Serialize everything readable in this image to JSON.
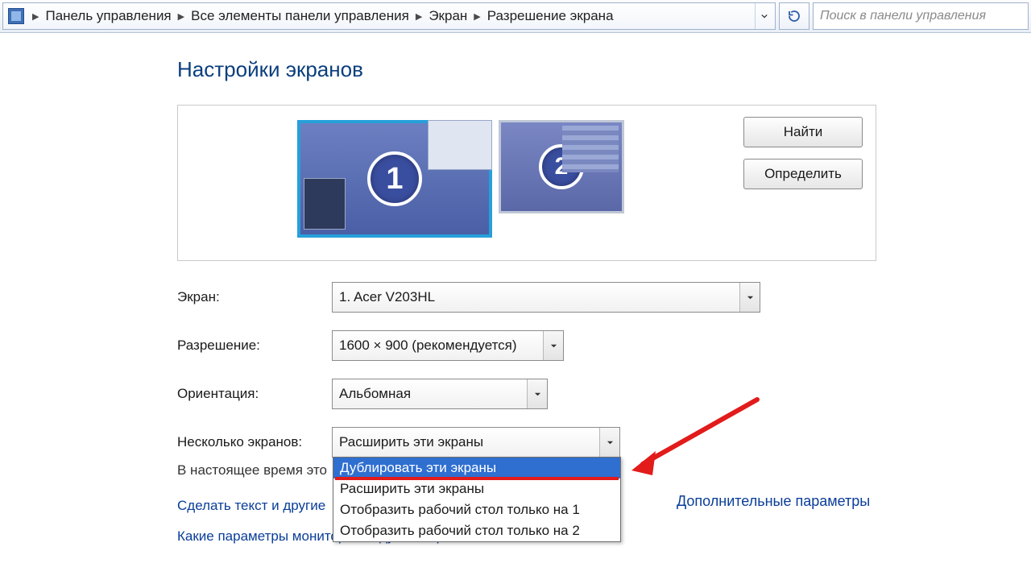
{
  "breadcrumb": {
    "items": [
      "Панель управления",
      "Все элементы панели управления",
      "Экран",
      "Разрешение экрана"
    ]
  },
  "search": {
    "placeholder": "Поиск в панели управления"
  },
  "title": "Настройки экранов",
  "monitors": {
    "m1": "1",
    "m2": "2"
  },
  "buttons": {
    "find": "Найти",
    "identify": "Определить"
  },
  "labels": {
    "display": "Экран:",
    "resolution": "Разрешение:",
    "orientation": "Ориентация:",
    "multi": "Несколько экранов:"
  },
  "values": {
    "display": "1. Acer V203HL",
    "resolution": "1600 × 900 (рекомендуется)",
    "orientation": "Альбомная",
    "multi": "Расширить эти экраны"
  },
  "multi_options": [
    "Дублировать эти экраны",
    "Расширить эти экраны",
    "Отобразить рабочий стол только на 1",
    "Отобразить рабочий стол только на 2"
  ],
  "truncated_msg": "В настоящее время это",
  "link_textsize": "Сделать текст и другие",
  "link_which": "Какие параметры монитора следует выбрать?",
  "link_advanced": "Дополнительные параметры"
}
